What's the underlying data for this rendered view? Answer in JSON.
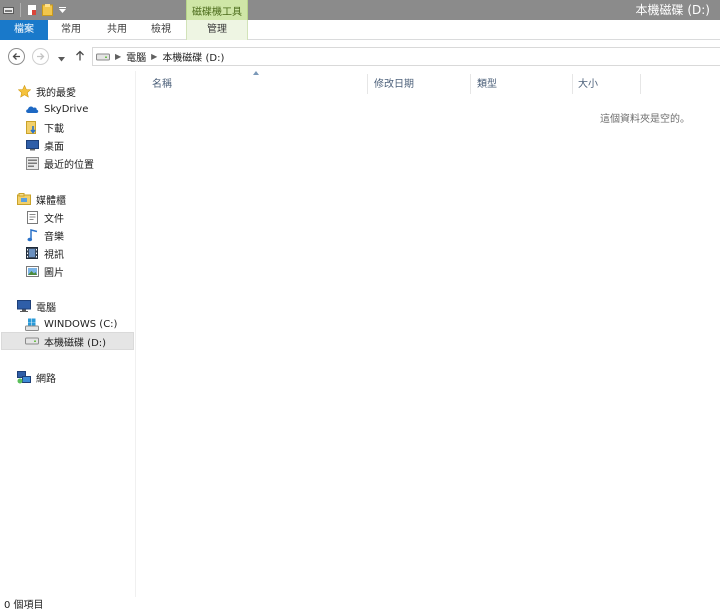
{
  "window": {
    "title": "本機磁碟 (D:)",
    "contextual_tab_group": "磁碟機工具"
  },
  "ribbon": {
    "tabs": [
      {
        "label": "檔案"
      },
      {
        "label": "常用"
      },
      {
        "label": "共用"
      },
      {
        "label": "檢視"
      },
      {
        "label": "管理"
      }
    ]
  },
  "address": {
    "crumbs": [
      "電腦",
      "本機磁碟 (D:)"
    ]
  },
  "sidebar": {
    "favorites": {
      "label": "我的最愛",
      "items": [
        {
          "label": "SkyDrive",
          "icon": "cloud-icon"
        },
        {
          "label": "下載",
          "icon": "download-folder-icon"
        },
        {
          "label": "桌面",
          "icon": "desktop-icon"
        },
        {
          "label": "最近的位置",
          "icon": "recent-places-icon"
        }
      ]
    },
    "libraries": {
      "label": "媒體櫃",
      "items": [
        {
          "label": "文件",
          "icon": "documents-icon"
        },
        {
          "label": "音樂",
          "icon": "music-icon"
        },
        {
          "label": "視訊",
          "icon": "video-icon"
        },
        {
          "label": "圖片",
          "icon": "pictures-icon"
        }
      ]
    },
    "computer": {
      "label": "電腦",
      "items": [
        {
          "label": "WINDOWS (C:)",
          "icon": "windows-drive-icon"
        },
        {
          "label": "本機磁碟 (D:)",
          "icon": "hard-drive-icon",
          "selected": true
        }
      ]
    },
    "network": {
      "label": "網路"
    }
  },
  "columns": [
    {
      "label": "名稱"
    },
    {
      "label": "修改日期"
    },
    {
      "label": "類型"
    },
    {
      "label": "大小"
    }
  ],
  "content": {
    "empty_message": "這個資料夾是空的。"
  },
  "status": {
    "item_count": "0 個項目"
  },
  "colors": {
    "title_bar": "#8b8b8b",
    "file_tab": "#1979ca",
    "tools_tab": "#cfe6a7",
    "selection": "#e5e5e5"
  }
}
